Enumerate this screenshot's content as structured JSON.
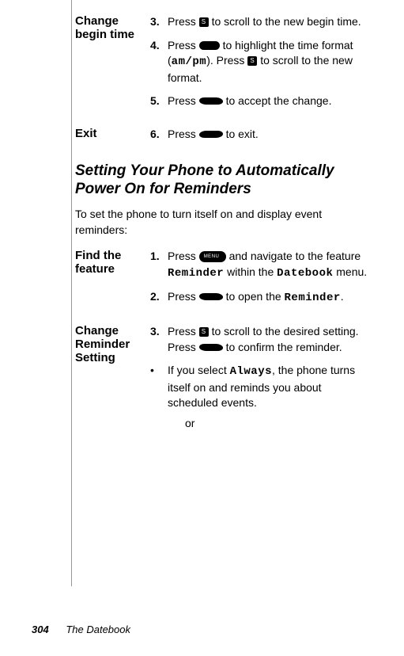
{
  "block1": {
    "label": "Change begin time",
    "step3_num": "3.",
    "step3_a": "Press ",
    "step3_b": " to scroll to the new begin time.",
    "step4_num": "4.",
    "step4_a": "Press ",
    "step4_b": " to highlight the time format (",
    "step4_c": "am/pm",
    "step4_d": "). Press ",
    "step4_e": " to scroll to the new format.",
    "step5_num": "5.",
    "step5_a": "Press ",
    "step5_b": " to accept the change."
  },
  "block2": {
    "label": "Exit",
    "step6_num": "6.",
    "step6_a": "Press ",
    "step6_b": " to exit."
  },
  "section_title": "Setting Your Phone to Automatically Power On for Reminders",
  "section_intro": "To set the phone to turn itself on and display event reminders:",
  "block3": {
    "label": "Find the feature",
    "step1_num": "1.",
    "step1_a": "Press ",
    "step1_b": " and navigate to the feature ",
    "step1_c": "Reminder",
    "step1_d": " within the ",
    "step1_e": "Datebook",
    "step1_f": " menu.",
    "step2_num": "2.",
    "step2_a": "Press ",
    "step2_b": " to open the ",
    "step2_c": "Reminder",
    "step2_d": "."
  },
  "block4": {
    "label": "Change Reminder Setting",
    "step3_num": "3.",
    "step3_a": "Press ",
    "step3_b": " to scroll to the desired setting. Press ",
    "step3_c": " to confirm the reminder.",
    "bullet_a": "If you select ",
    "bullet_b": "Always",
    "bullet_c": ", the phone turns itself on and reminds you about scheduled events.",
    "or": "or"
  },
  "footer": {
    "page": "304",
    "chapter": "The Datebook"
  }
}
